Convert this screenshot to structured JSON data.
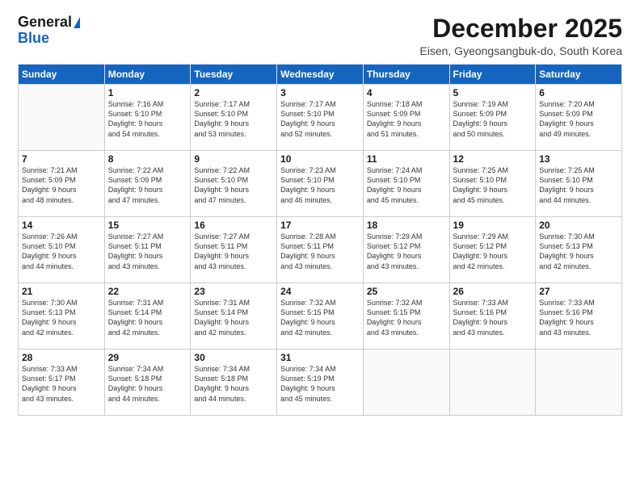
{
  "header": {
    "logo_general": "General",
    "logo_blue": "Blue",
    "month_title": "December 2025",
    "subtitle": "Eisen, Gyeongsangbuk-do, South Korea"
  },
  "weekdays": [
    "Sunday",
    "Monday",
    "Tuesday",
    "Wednesday",
    "Thursday",
    "Friday",
    "Saturday"
  ],
  "weeks": [
    [
      {
        "day": "",
        "info": ""
      },
      {
        "day": "1",
        "info": "Sunrise: 7:16 AM\nSunset: 5:10 PM\nDaylight: 9 hours\nand 54 minutes."
      },
      {
        "day": "2",
        "info": "Sunrise: 7:17 AM\nSunset: 5:10 PM\nDaylight: 9 hours\nand 53 minutes."
      },
      {
        "day": "3",
        "info": "Sunrise: 7:17 AM\nSunset: 5:10 PM\nDaylight: 9 hours\nand 52 minutes."
      },
      {
        "day": "4",
        "info": "Sunrise: 7:18 AM\nSunset: 5:09 PM\nDaylight: 9 hours\nand 51 minutes."
      },
      {
        "day": "5",
        "info": "Sunrise: 7:19 AM\nSunset: 5:09 PM\nDaylight: 9 hours\nand 50 minutes."
      },
      {
        "day": "6",
        "info": "Sunrise: 7:20 AM\nSunset: 5:09 PM\nDaylight: 9 hours\nand 49 minutes."
      }
    ],
    [
      {
        "day": "7",
        "info": "Sunrise: 7:21 AM\nSunset: 5:09 PM\nDaylight: 9 hours\nand 48 minutes."
      },
      {
        "day": "8",
        "info": "Sunrise: 7:22 AM\nSunset: 5:09 PM\nDaylight: 9 hours\nand 47 minutes."
      },
      {
        "day": "9",
        "info": "Sunrise: 7:22 AM\nSunset: 5:10 PM\nDaylight: 9 hours\nand 47 minutes."
      },
      {
        "day": "10",
        "info": "Sunrise: 7:23 AM\nSunset: 5:10 PM\nDaylight: 9 hours\nand 46 minutes."
      },
      {
        "day": "11",
        "info": "Sunrise: 7:24 AM\nSunset: 5:10 PM\nDaylight: 9 hours\nand 45 minutes."
      },
      {
        "day": "12",
        "info": "Sunrise: 7:25 AM\nSunset: 5:10 PM\nDaylight: 9 hours\nand 45 minutes."
      },
      {
        "day": "13",
        "info": "Sunrise: 7:25 AM\nSunset: 5:10 PM\nDaylight: 9 hours\nand 44 minutes."
      }
    ],
    [
      {
        "day": "14",
        "info": "Sunrise: 7:26 AM\nSunset: 5:10 PM\nDaylight: 9 hours\nand 44 minutes."
      },
      {
        "day": "15",
        "info": "Sunrise: 7:27 AM\nSunset: 5:11 PM\nDaylight: 9 hours\nand 43 minutes."
      },
      {
        "day": "16",
        "info": "Sunrise: 7:27 AM\nSunset: 5:11 PM\nDaylight: 9 hours\nand 43 minutes."
      },
      {
        "day": "17",
        "info": "Sunrise: 7:28 AM\nSunset: 5:11 PM\nDaylight: 9 hours\nand 43 minutes."
      },
      {
        "day": "18",
        "info": "Sunrise: 7:29 AM\nSunset: 5:12 PM\nDaylight: 9 hours\nand 43 minutes."
      },
      {
        "day": "19",
        "info": "Sunrise: 7:29 AM\nSunset: 5:12 PM\nDaylight: 9 hours\nand 42 minutes."
      },
      {
        "day": "20",
        "info": "Sunrise: 7:30 AM\nSunset: 5:13 PM\nDaylight: 9 hours\nand 42 minutes."
      }
    ],
    [
      {
        "day": "21",
        "info": "Sunrise: 7:30 AM\nSunset: 5:13 PM\nDaylight: 9 hours\nand 42 minutes."
      },
      {
        "day": "22",
        "info": "Sunrise: 7:31 AM\nSunset: 5:14 PM\nDaylight: 9 hours\nand 42 minutes."
      },
      {
        "day": "23",
        "info": "Sunrise: 7:31 AM\nSunset: 5:14 PM\nDaylight: 9 hours\nand 42 minutes."
      },
      {
        "day": "24",
        "info": "Sunrise: 7:32 AM\nSunset: 5:15 PM\nDaylight: 9 hours\nand 42 minutes."
      },
      {
        "day": "25",
        "info": "Sunrise: 7:32 AM\nSunset: 5:15 PM\nDaylight: 9 hours\nand 43 minutes."
      },
      {
        "day": "26",
        "info": "Sunrise: 7:33 AM\nSunset: 5:16 PM\nDaylight: 9 hours\nand 43 minutes."
      },
      {
        "day": "27",
        "info": "Sunrise: 7:33 AM\nSunset: 5:16 PM\nDaylight: 9 hours\nand 43 minutes."
      }
    ],
    [
      {
        "day": "28",
        "info": "Sunrise: 7:33 AM\nSunset: 5:17 PM\nDaylight: 9 hours\nand 43 minutes."
      },
      {
        "day": "29",
        "info": "Sunrise: 7:34 AM\nSunset: 5:18 PM\nDaylight: 9 hours\nand 44 minutes."
      },
      {
        "day": "30",
        "info": "Sunrise: 7:34 AM\nSunset: 5:18 PM\nDaylight: 9 hours\nand 44 minutes."
      },
      {
        "day": "31",
        "info": "Sunrise: 7:34 AM\nSunset: 5:19 PM\nDaylight: 9 hours\nand 45 minutes."
      },
      {
        "day": "",
        "info": ""
      },
      {
        "day": "",
        "info": ""
      },
      {
        "day": "",
        "info": ""
      }
    ]
  ]
}
